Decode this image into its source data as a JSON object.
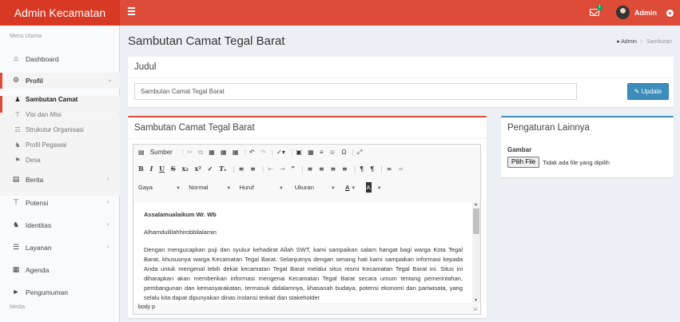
{
  "header": {
    "brand": "Admin Kecamatan",
    "mail_badge": "1",
    "user_name": "Admin"
  },
  "sidebar": {
    "section_main": "Menu Utama",
    "section_media": "Media",
    "items": [
      {
        "label": "Dashboard",
        "icon": "home-icon"
      },
      {
        "label": "Profil",
        "icon": "gear-icon"
      },
      {
        "label": "Berita",
        "icon": "newspaper-icon"
      },
      {
        "label": "Potensi",
        "icon": "signpost-icon"
      },
      {
        "label": "Identitas",
        "icon": "sitemap-icon"
      },
      {
        "label": "Layanan",
        "icon": "list-icon"
      },
      {
        "label": "Agenda",
        "icon": "calendar-icon"
      },
      {
        "label": "Pengumuman",
        "icon": "megaphone-icon"
      }
    ],
    "profil_sub": [
      {
        "label": "Sambutan Camat",
        "icon": "user-icon"
      },
      {
        "label": "Visi dan Misi",
        "icon": "pushpin-icon"
      },
      {
        "label": "Strukutur Organisasi",
        "icon": "sitemap-icon"
      },
      {
        "label": "Profil Pegawai",
        "icon": "users-icon"
      },
      {
        "label": "Desa",
        "icon": "flag-icon"
      }
    ]
  },
  "page": {
    "title": "Sambutan Camat Tegal Barat",
    "breadcrumb": [
      "Admin",
      "Sambutan"
    ]
  },
  "judul": {
    "title": "Judul",
    "value": "Sambutan Camat Tegal Barat",
    "update_label": "Update"
  },
  "editor": {
    "title": "Sambutan Camat Tegal Barat",
    "source_label": "Sumber",
    "combos": [
      "Gaya",
      "Normal",
      "Huruf",
      "Ukuran"
    ],
    "content": [
      "Assalamualaikum Wr. Wb",
      "Alhamdulillahhirobbilalamin",
      "Dengan mengucapkan puji dan syukur kehadirat Allah SWT, kami sampaikan salam hangat bagi warga Kota Tegal Barat, khususnya warga Kecamatan Tegal Barat. Selanjutnya dengan senang hati kami sampaikan informasi kepada Anda untuk mengenal lebih dekat kecamatan Tegal Barat melalui situs resmi Kecamatan Tegal Barat ini. Situs ini diharapkan akan memberikan informasi mengenai Kecamatan Tegal Barat secara umum tentang pemerintahan, pembangunan dan kemasyarakatan, termasuk didalamnya, khasanah budaya, potensi ekonomi dan pariwisata, yang selalu kita dapat dipunyakan dinas instansi terkait dan stakeholder"
    ],
    "status": "body  p"
  },
  "settings": {
    "title": "Pengaturan Lainnya",
    "gambar_label": "Gambar",
    "file_button": "Pilih File",
    "file_status": "Tidak ada file yang dipilih"
  }
}
